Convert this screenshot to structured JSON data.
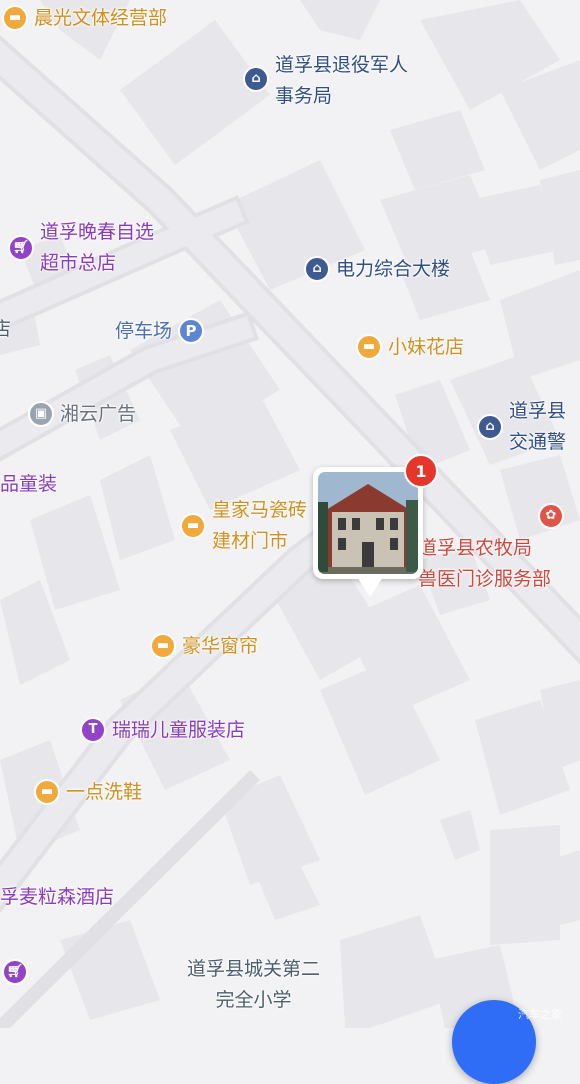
{
  "colors": {
    "land": "#f2f2f4",
    "road": "#e4e4e8",
    "block": "#e8e8ec",
    "accent": "#2f6df6",
    "badge": "#e6362c"
  },
  "pois": {
    "chenguang": {
      "label": "晨光文体经营部",
      "icon": "shop-icon"
    },
    "veterans": {
      "label": "道孚县退役军人\n事务局",
      "icon": "government-icon"
    },
    "wanchun": {
      "label": "道孚晚春自选\n超市总店",
      "icon": "cart-icon"
    },
    "power": {
      "label": "电力综合大楼",
      "icon": "building-icon"
    },
    "parking": {
      "label": "停车场",
      "icon": "parking-icon",
      "icon_text": "P"
    },
    "xiaomei": {
      "label": "小妹花店",
      "icon": "shop-icon"
    },
    "xiangyun": {
      "label": "湘云广告",
      "icon": "briefcase-icon"
    },
    "traffic": {
      "label": "道孚县\n交通警",
      "icon": "government-icon"
    },
    "kids_left": {
      "label": "品童装"
    },
    "tiles": {
      "label": "皇家马瓷砖\n建材门市",
      "icon": "shop-icon"
    },
    "vet": {
      "label": "道孚县农牧局\n兽医门诊服务部",
      "icon": "paw-icon"
    },
    "curtains": {
      "label": "豪华窗帘",
      "icon": "shop-icon"
    },
    "ruirui": {
      "label": "瑞瑞儿童服装店",
      "icon": "shirt-icon"
    },
    "shoes": {
      "label": "一点洗鞋",
      "icon": "shop-icon"
    },
    "hotel": {
      "label": "孚麦粒森酒店"
    },
    "cart_bottom": {
      "icon": "cart-icon"
    },
    "school": {
      "label": "道孚县城关第二\n完全小学"
    },
    "left_edge": {
      "label": "店"
    }
  },
  "photo_marker": {
    "count": "1"
  },
  "watermark": "汽车之家"
}
